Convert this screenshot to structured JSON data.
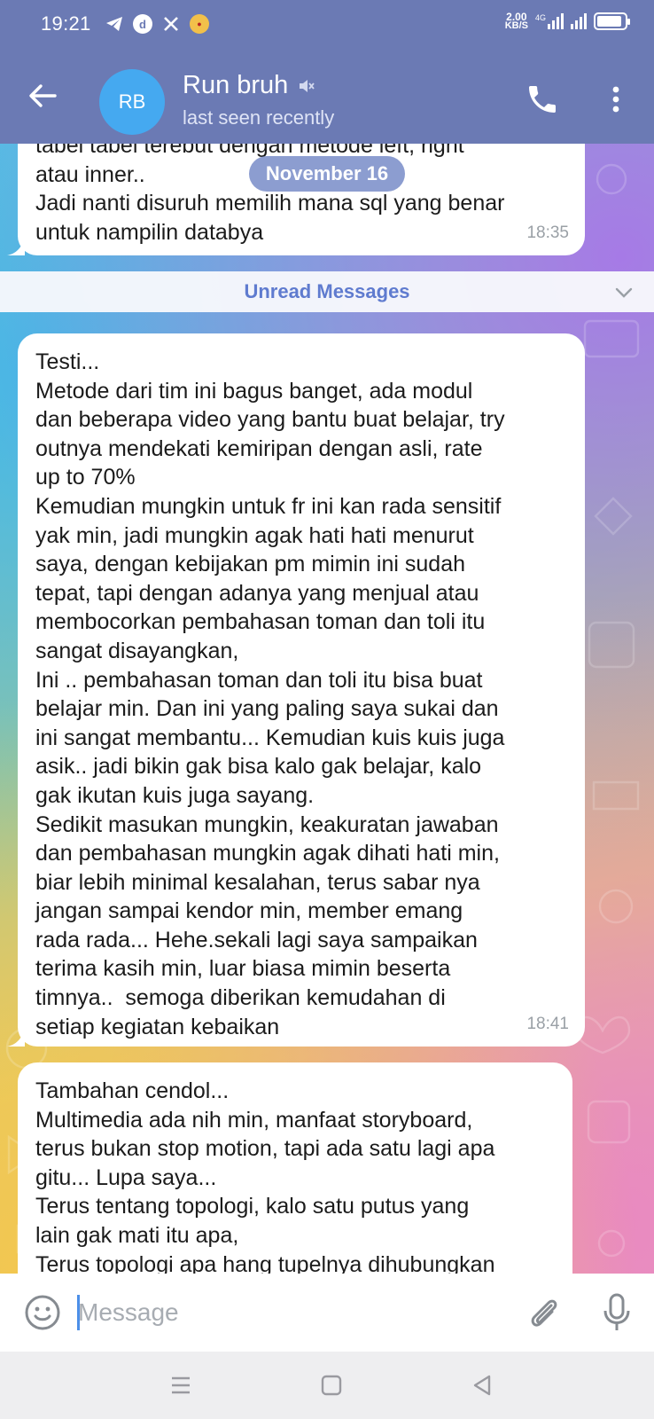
{
  "status_bar": {
    "time": "19:21",
    "left_icons": [
      "telegram-icon",
      "app-icon",
      "x-icon",
      "badge-icon"
    ],
    "net_speed_value": "2.00",
    "net_speed_unit": "KB/S",
    "network_type": "4G",
    "battery_level": 0.9
  },
  "header": {
    "avatar_initials": "RB",
    "chat_name": "Run bruh",
    "chat_status": "last seen recently",
    "muted": true
  },
  "chat": {
    "date_pill": "November 16",
    "unread_label": "Unread Messages",
    "messages": [
      {
        "text": "tabel tabel terebut dengan metode left, right\natau inner..\nJadi nanti disuruh memilih mana sql yang benar\nuntuk nampilin databya",
        "time": "18:35"
      },
      {
        "text": "Testi...\nMetode dari tim ini bagus banget, ada modul\ndan beberapa video yang bantu buat belajar, try\noutnya mendekati kemiripan dengan asli, rate\nup to 70%\nKemudian mungkin untuk fr ini kan rada sensitif\nyak min, jadi mungkin agak hati hati menurut\nsaya, dengan kebijakan pm mimin ini sudah\ntepat, tapi dengan adanya yang menjual atau\nmembocorkan pembahasan toman dan toli itu\nsangat disayangkan,\nIni .. pembahasan toman dan toli itu bisa buat\nbelajar min. Dan ini yang paling saya sukai dan\nini sangat membantu... Kemudian kuis kuis juga\nasik.. jadi bikin gak bisa kalo gak belajar, kalo\ngak ikutan kuis juga sayang.\nSedikit masukan mungkin, keakuratan jawaban\ndan pembahasan mungkin agak dihati hati min,\nbiar lebih minimal kesalahan, terus sabar nya\njangan sampai kendor min, member emang\nrada rada... Hehe.sekali lagi saya sampaikan\nterima kasih min, luar biasa mimin beserta\ntimnya..  semoga diberikan kemudahan di\nsetiap kegiatan kebaikan",
        "time": "18:41"
      },
      {
        "text": "Tambahan cendol...\nMultimedia ada nih min, manfaat storyboard,\nterus bukan stop motion, tapi ada satu lagi apa\ngitu... Lupa saya...\nTerus tentang topologi, kalo satu putus yang\nlain gak mati itu apa,\nTerus topologi apa hang tupelnya dihubungkan",
        "time": ""
      }
    ]
  },
  "input": {
    "placeholder": "Message",
    "value": ""
  },
  "colors": {
    "header_bg": "#6b7ab4",
    "avatar_bg": "#45a9f0",
    "unread_text": "#5f7bcf",
    "caret": "#4c8fe8"
  }
}
